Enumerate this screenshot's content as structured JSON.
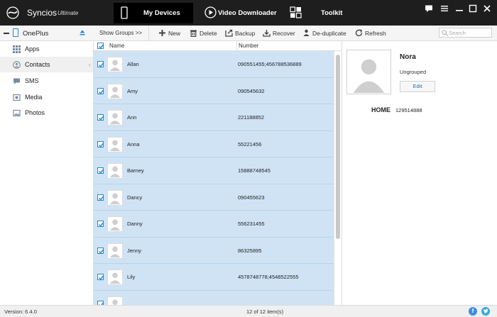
{
  "titlebar": {
    "app_name": "Syncios",
    "app_edition": "Ultimate",
    "tabs": [
      {
        "label": "My Devices",
        "icon": "phone-icon",
        "active": true
      },
      {
        "label": "Video Downloader",
        "icon": "play-icon",
        "active": false
      },
      {
        "label": "Toolkit",
        "icon": "toolkit-icon",
        "active": false
      }
    ]
  },
  "toolbar": {
    "device_name": "OnePlus",
    "show_groups_label": "Show Groups >>",
    "new_label": "New",
    "delete_label": "Delete",
    "backup_label": "Backup",
    "recover_label": "Recover",
    "deduplicate_label": "De-duplicate",
    "refresh_label": "Refresh",
    "search_placeholder": "Search"
  },
  "sidebar": {
    "items": [
      {
        "label": "Apps",
        "icon": "apps-grid-icon"
      },
      {
        "label": "Contacts",
        "icon": "contacts-icon",
        "active": true
      },
      {
        "label": "SMS",
        "icon": "sms-icon"
      },
      {
        "label": "Media",
        "icon": "media-icon"
      },
      {
        "label": "Photos",
        "icon": "photos-icon"
      }
    ]
  },
  "list": {
    "col_name": "Name",
    "col_number": "Number",
    "rows": [
      {
        "name": "Allan",
        "number": "090551455;456788536889"
      },
      {
        "name": "Amy",
        "number": "090545632"
      },
      {
        "name": "Ann",
        "number": "221188852"
      },
      {
        "name": "Anna",
        "number": "55221456"
      },
      {
        "name": "Barney",
        "number": "15888748545"
      },
      {
        "name": "Dancy",
        "number": "090455623"
      },
      {
        "name": "Danny",
        "number": "556231455"
      },
      {
        "name": "Jenny",
        "number": "86325895"
      },
      {
        "name": "Lily",
        "number": "4578748778;4548522555"
      },
      {
        "name": "",
        "number": ""
      }
    ]
  },
  "detail": {
    "name": "Nora",
    "group": "Ungrouped",
    "edit_label": "Edit",
    "phone_label": "HOME",
    "phone_value": "129514888"
  },
  "status": {
    "version": "Version: 6.4.0",
    "count": "12 of 12 item(s)"
  },
  "colors": {
    "accent": "#1f8ad0",
    "selection": "#cfe3f4",
    "titlebar": "#1e1e1e",
    "facebook": "#3b8fd9",
    "twitter": "#39a9e0"
  }
}
